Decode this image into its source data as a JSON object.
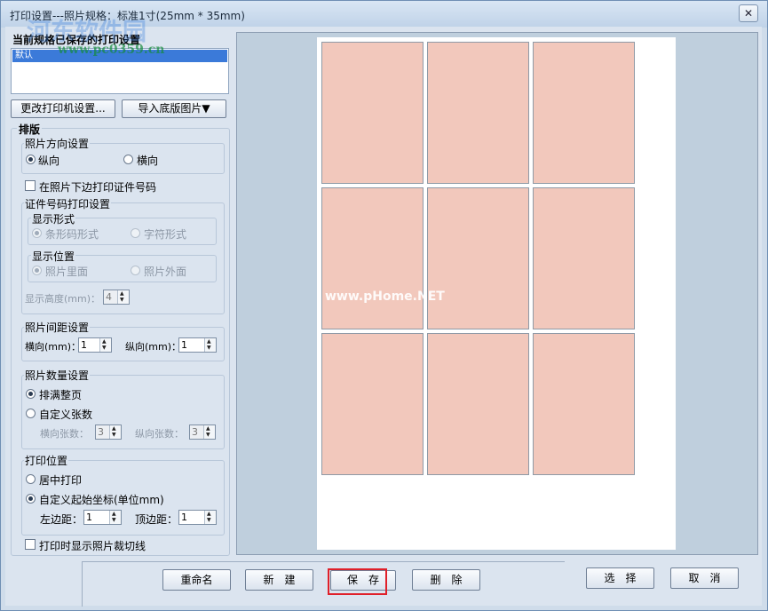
{
  "window": {
    "title": "打印设置---照片规格：标准1寸(25mm * 35mm)",
    "close_glyph": "✕"
  },
  "watermarks": {
    "logo_text": "河东软件园",
    "logo_url": "www.pc0359.cn",
    "site": "www.pHome.NET"
  },
  "saved": {
    "label": "当前规格已保存的打印设置",
    "items": [
      "默认"
    ]
  },
  "buttons": {
    "printer_settings": "更改打印机设置...",
    "import_background": "导入底版图片▼"
  },
  "layout": {
    "heading": "排版",
    "orientation": {
      "title": "照片方向设置",
      "portrait": "纵向",
      "landscape": "横向"
    },
    "print_id_checkbox": "在照片下边打印证件号码",
    "id_print": {
      "title": "证件号码打印设置",
      "display_form": {
        "title": "显示形式",
        "barcode": "条形码形式",
        "text": "字符形式"
      },
      "display_position": {
        "title": "显示位置",
        "inside": "照片里面",
        "outside": "照片外面"
      },
      "height_label": "显示高度(mm)：",
      "height_value": "4"
    },
    "spacing": {
      "title": "照片间距设置",
      "h_label": "横向(mm)：",
      "h_value": "1",
      "v_label": "纵向(mm)：",
      "v_value": "1"
    },
    "quantity": {
      "title": "照片数量设置",
      "fill_page": "排满整页",
      "custom": "自定义张数",
      "h_count_label": "横向张数：",
      "h_count": "3",
      "v_count_label": "纵向张数：",
      "v_count": "3"
    },
    "position": {
      "title": "打印位置",
      "center": "居中打印",
      "custom": "自定义起始坐标(单位mm)",
      "left_label": "左边距：",
      "left_value": "1",
      "top_label": "顶边距：",
      "top_value": "1"
    },
    "cut_lines_checkbox": "打印时显示照片裁切线"
  },
  "preview": {
    "rows": 3,
    "cols": 3,
    "photo_color": "#f2c8bc"
  },
  "actions": {
    "rename": "重命名",
    "new": "新　建",
    "save": "保　存",
    "delete": "删　除",
    "select": "选　择",
    "cancel": "取　消"
  },
  "colors": {
    "highlight": "#e0202a",
    "selection": "#3b7ad9"
  }
}
